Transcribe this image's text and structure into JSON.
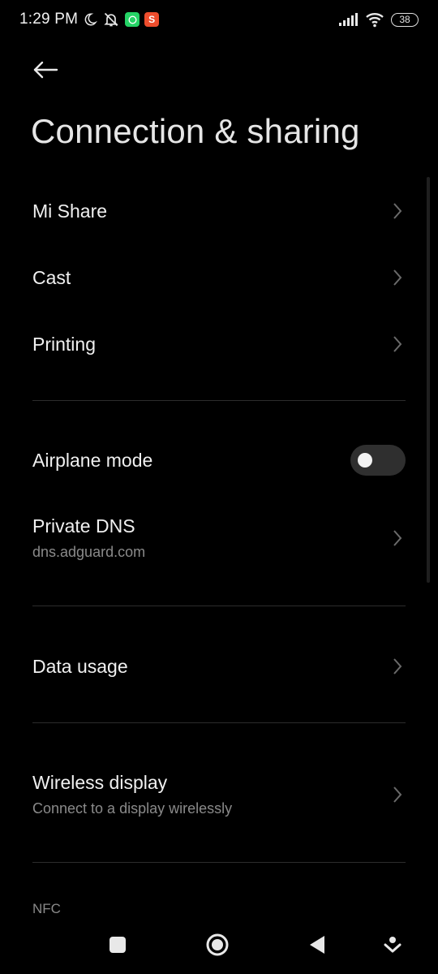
{
  "status_bar": {
    "time": "1:29 PM",
    "battery": "38",
    "icons_left": [
      "moon-icon",
      "bell-off-icon",
      "whatsapp-icon",
      "shopee-icon"
    ],
    "icons_right": [
      "signal-icon",
      "wifi-icon",
      "battery-icon"
    ]
  },
  "header": {
    "back_icon": "arrow-left-icon",
    "title": "Connection & sharing"
  },
  "items": {
    "mi_share": {
      "label": "Mi Share"
    },
    "cast": {
      "label": "Cast"
    },
    "printing": {
      "label": "Printing"
    },
    "airplane": {
      "label": "Airplane mode",
      "enabled": false
    },
    "private_dns": {
      "label": "Private DNS",
      "sub": "dns.adguard.com"
    },
    "data_usage": {
      "label": "Data usage"
    },
    "wireless_display": {
      "label": "Wireless display",
      "sub": "Connect to a display wirelessly"
    }
  },
  "section": {
    "nfc": "NFC"
  },
  "nav": [
    "recent-apps-icon",
    "home-icon",
    "back-icon",
    "assistant-icon"
  ],
  "colors": {
    "background": "#000000",
    "text": "#f0f0f0",
    "subtext": "#8a8a8a",
    "divider": "#2c2c2c"
  }
}
